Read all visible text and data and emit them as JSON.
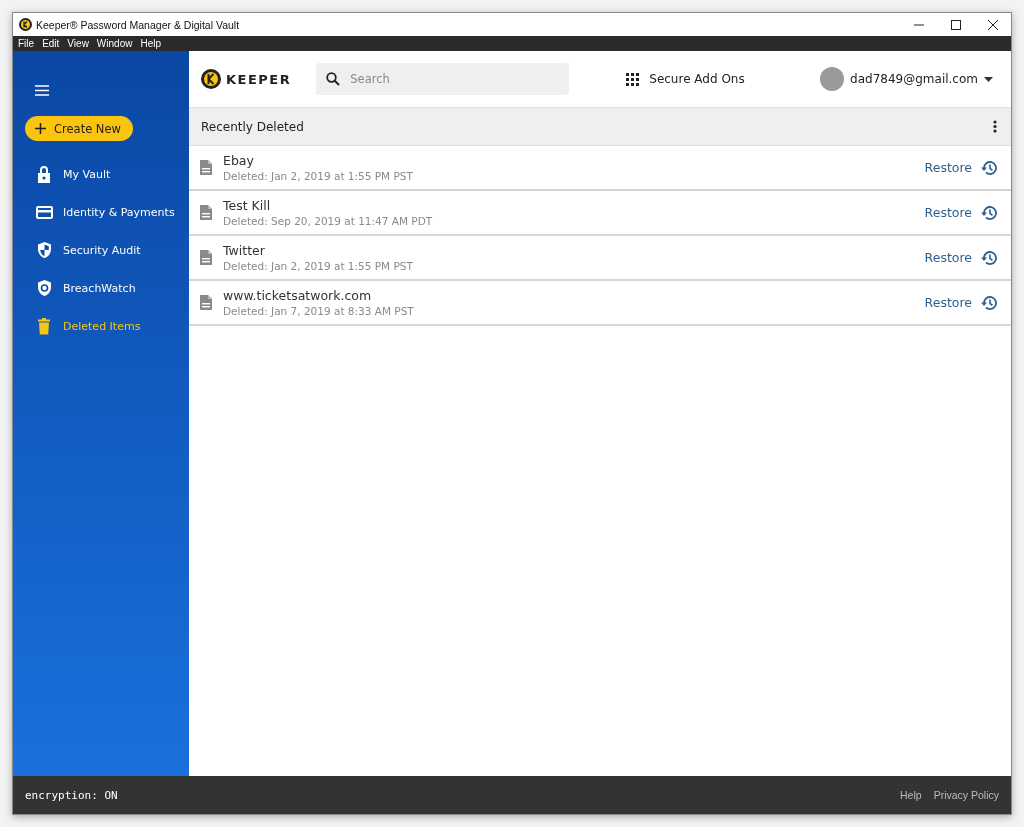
{
  "window": {
    "title": "Keeper® Password Manager & Digital Vault"
  },
  "menu_bar": [
    "File",
    "Edit",
    "View",
    "Window",
    "Help"
  ],
  "sidebar": {
    "create_button": "Create New",
    "items": [
      {
        "label": "My Vault",
        "kind": "lock",
        "selected": false
      },
      {
        "label": "Identity & Payments",
        "kind": "card",
        "selected": false
      },
      {
        "label": "Security Audit",
        "kind": "shield",
        "selected": false
      },
      {
        "label": "BreachWatch",
        "kind": "watch",
        "selected": false
      },
      {
        "label": "Deleted Items",
        "kind": "trash",
        "selected": true
      }
    ]
  },
  "top_bar": {
    "logo": "KEEPER",
    "search": {
      "placeholder": "Search"
    },
    "addons": "Secure Add Ons",
    "account": "dad7849@gmail.com"
  },
  "list": {
    "title": "Recently Deleted",
    "items": [
      {
        "name": "Ebay",
        "deleted": "Deleted: Jan 2, 2019 at 1:55 PM PST",
        "action": "Restore"
      },
      {
        "name": "Test Kill",
        "deleted": "Deleted: Sep 20, 2019 at 11:47 AM PDT",
        "action": "Restore"
      },
      {
        "name": "Twitter",
        "deleted": "Deleted: Jan 2, 2019 at 1:55 PM PST",
        "action": "Restore"
      },
      {
        "name": "www.ticketsatwork.com",
        "deleted": "Deleted: Jan 7, 2019 at 8:33 AM PST",
        "action": "Restore"
      }
    ]
  },
  "footer": {
    "status": "encryption: ON",
    "links": [
      "Help",
      "Privacy Policy"
    ]
  }
}
